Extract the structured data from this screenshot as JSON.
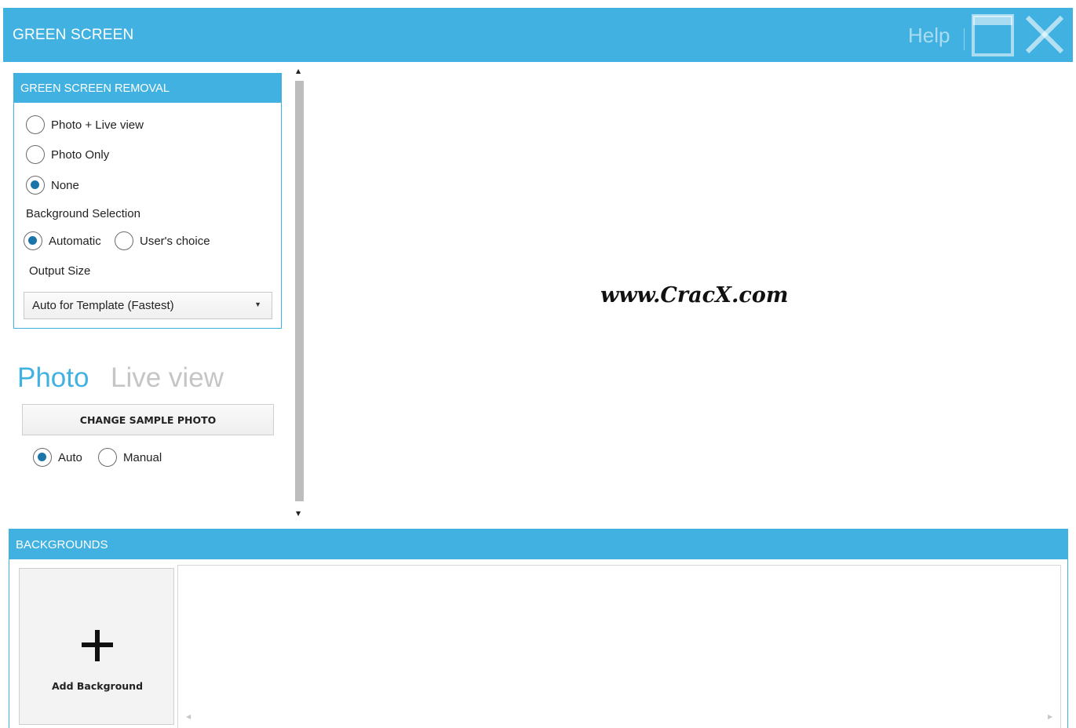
{
  "titlebar": {
    "title": "GREEN SCREEN",
    "help_label": "Help"
  },
  "green_screen_removal": {
    "header": "GREEN SCREEN REMOVAL",
    "options": [
      {
        "label": "Photo + Live view",
        "selected": false
      },
      {
        "label": "Photo Only",
        "selected": false
      },
      {
        "label": "None",
        "selected": true
      }
    ],
    "background_selection_label": "Background Selection",
    "background_options": [
      {
        "label": "Automatic",
        "selected": true
      },
      {
        "label": "User's choice",
        "selected": false
      }
    ],
    "output_size_label": "Output Size",
    "output_size_value": "Auto for Template (Fastest)"
  },
  "view_tabs": {
    "photo": "Photo",
    "live_view": "Live view"
  },
  "change_sample_button": "CHANGE SAMPLE PHOTO",
  "mode_options": [
    {
      "label": "Auto",
      "selected": true
    },
    {
      "label": "Manual",
      "selected": false
    }
  ],
  "preview": {
    "watermark": "www.CracX.com"
  },
  "backgrounds": {
    "header": "BACKGROUNDS",
    "add_label": "Add Background"
  },
  "colors": {
    "accent": "#41b1e1",
    "radio_fill": "#1a74a8",
    "inactive_tab": "#c5c5c5"
  }
}
